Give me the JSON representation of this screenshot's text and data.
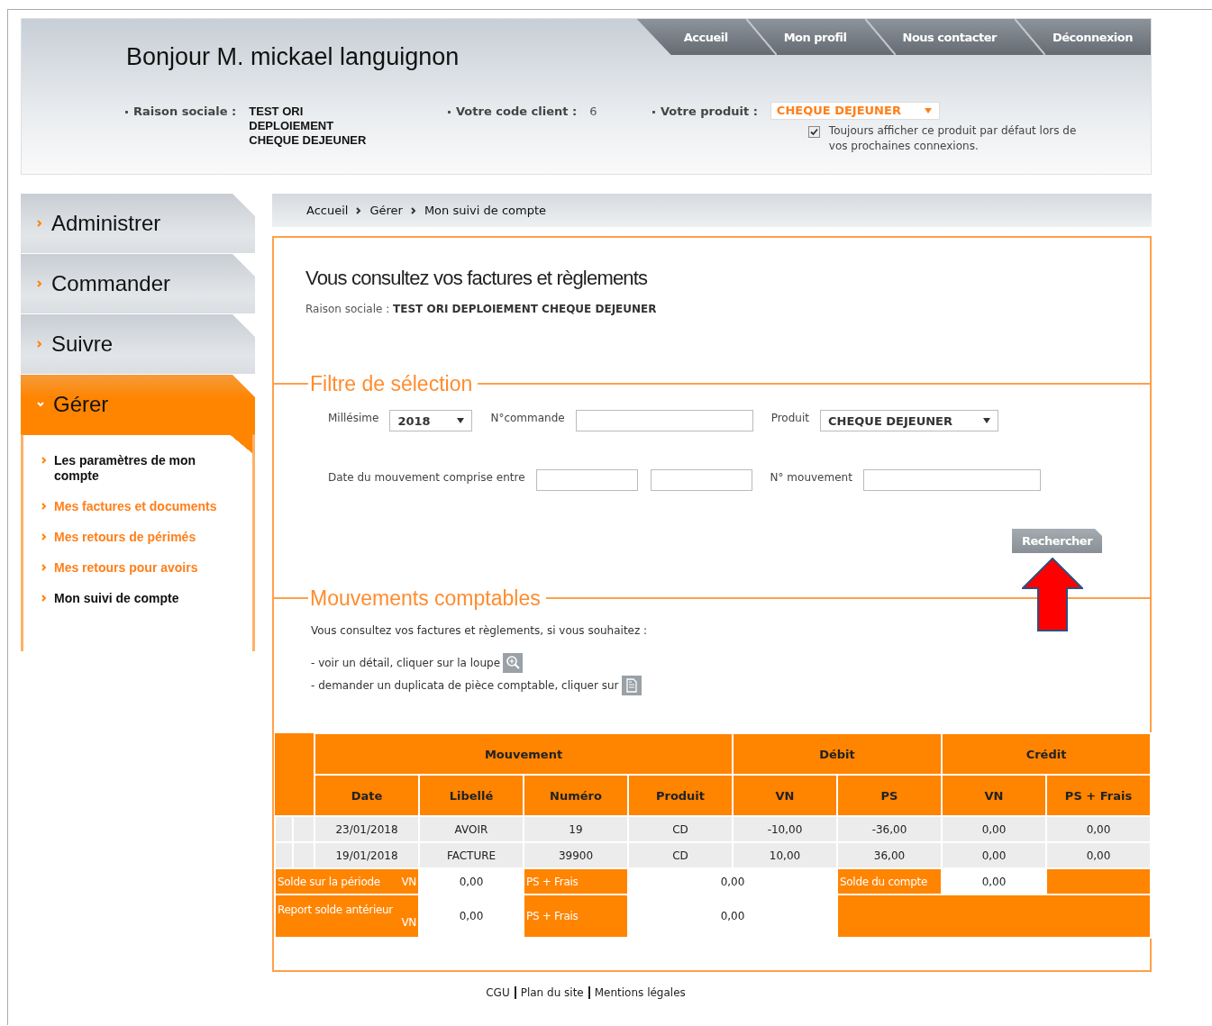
{
  "header": {
    "greeting": "Bonjour M. mickael languignon",
    "nav": [
      {
        "label": "Accueil"
      },
      {
        "label": "Mon profil"
      },
      {
        "label": "Nous contacter"
      },
      {
        "label": "Déconnexion"
      }
    ],
    "company": {
      "label": "Raison sociale :",
      "lines": [
        "TEST ORI",
        "DEPLOIEMENT",
        "CHEQUE DEJEUNER"
      ]
    },
    "client_code": {
      "label": "Votre code client :",
      "value": "6"
    },
    "product": {
      "label": "Votre produit :",
      "value": "CHEQUE DEJEUNER"
    },
    "remember": {
      "label": "Toujours afficher ce produit par défaut lors de vos prochaines connexions.",
      "checked": true
    }
  },
  "sidebar": {
    "menus": [
      {
        "label": "Administrer",
        "expanded": false
      },
      {
        "label": "Commander",
        "expanded": false
      },
      {
        "label": "Suivre",
        "expanded": false
      },
      {
        "label": "Gérer",
        "expanded": true,
        "children": [
          {
            "label": "Les paramètres de mon compte",
            "color": "#111111"
          },
          {
            "label": "Mes factures et documents",
            "color": "#ff7f1a"
          },
          {
            "label": "Mes retours de périmés",
            "color": "#ff7f1a"
          },
          {
            "label": "Mes retours pour avoirs",
            "color": "#ff7f1a"
          },
          {
            "label": "Mon suivi de compte",
            "color": "#111111"
          }
        ]
      }
    ]
  },
  "breadcrumb": [
    "Accueil",
    "Gérer",
    "Mon suivi de compte"
  ],
  "page": {
    "title": "Vous consultez vos factures et règlements",
    "company_label": "Raison sociale :",
    "company_value": "TEST ORI DEPLOIEMENT CHEQUE DEJEUNER"
  },
  "filter": {
    "legend": "Filtre de sélection",
    "fields": [
      {
        "kind": "select",
        "label": "Millésime",
        "value": "2018"
      },
      {
        "kind": "input",
        "label": "N°commande"
      },
      {
        "kind": "select",
        "label": "Produit",
        "value": "CHEQUE DEJEUNER"
      },
      {
        "kind": "range",
        "label": "Date du mouvement comprise entre"
      },
      {
        "kind": "input",
        "label": "N° mouvement"
      }
    ],
    "button": "Rechercher"
  },
  "movements": {
    "legend": "Mouvements comptables",
    "intro": "Vous consultez vos factures et règlements, si vous souhaitez :",
    "hints": [
      {
        "kind": "magnifier",
        "text": "- voir un détail, cliquer sur la loupe"
      },
      {
        "kind": "document",
        "text": "- demander un duplicata de pièce comptable, cliquer sur"
      }
    ]
  },
  "table": {
    "groups": [
      "Mouvement",
      "Débit",
      "Crédit"
    ],
    "columns": [
      "Date",
      "Libellé",
      "Numéro",
      "Produit",
      "VN",
      "PS",
      "VN",
      "PS + Frais"
    ],
    "rows": [
      [
        "23/01/2018",
        "AVOIR",
        "19",
        "CD",
        "-10,00",
        "-36,00",
        "0,00",
        "0,00"
      ],
      [
        "19/01/2018",
        "FACTURE",
        "39900",
        "CD",
        "10,00",
        "36,00",
        "0,00",
        "0,00"
      ]
    ],
    "period": {
      "label": "Solde sur la période",
      "sublabel": "VN",
      "vn": "0,00",
      "ps_label": "PS + Frais",
      "ps": "0,00",
      "balance_label": "Solde du compte",
      "balance": "0,00"
    },
    "carry": {
      "label": "Report solde antérieur",
      "sublabel": "VN",
      "vn": "0,00",
      "ps_label": "PS + Frais",
      "ps": "0,00"
    }
  },
  "footer": [
    "CGU",
    "Plan du site",
    "Mentions légales"
  ]
}
